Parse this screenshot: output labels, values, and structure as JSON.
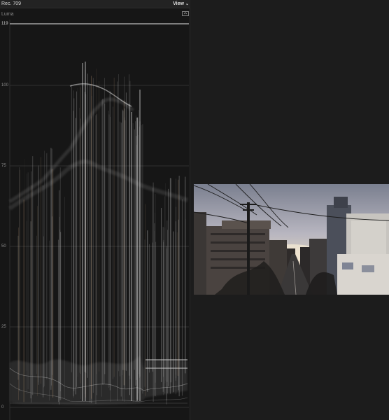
{
  "scope": {
    "title": "Rec. 709",
    "view_label": "View",
    "mode_label": "Luma",
    "max_label": "119",
    "ticks": [
      "100",
      "75",
      "50",
      "25",
      "0"
    ]
  },
  "colors": {
    "panel_bg": "#161616",
    "app_bg": "#1c1c1c",
    "trace": "#d8d8d8",
    "trace_warm": "#c9a27a",
    "grid": "#3a3a3a"
  },
  "icons": {
    "view_menu": "chevron-down-icon",
    "display_options": "display-settings-icon"
  }
}
